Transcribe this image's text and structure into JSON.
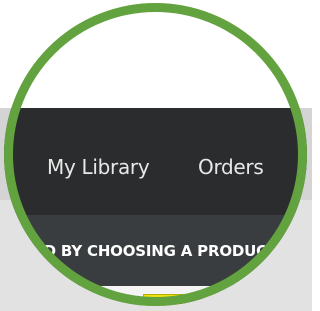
{
  "navigation": {
    "items": [
      {
        "label": "My Library"
      },
      {
        "label": "Orders"
      }
    ]
  },
  "promo": {
    "text": "STARTED BY CHOOSING A PRODUCT"
  },
  "colors": {
    "lens_ring": "#62a33f",
    "navbar": "#2a2c2d",
    "promo_band": "#3a3d3f",
    "product_yellow": "#f0e30c"
  }
}
